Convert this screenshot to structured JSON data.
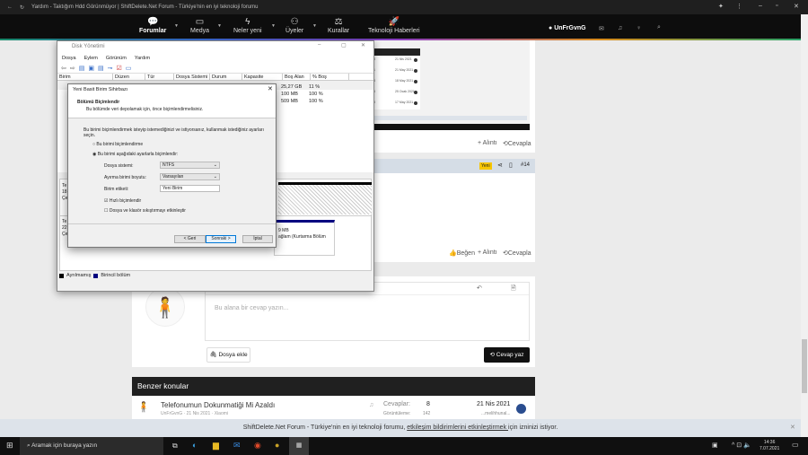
{
  "browser": {
    "tab_title": "Yardım - Taktığım Hdd Görünmüyor | ShiftDelete.Net Forum - Türkiye'nin en iyi teknoloji forumu"
  },
  "nav": {
    "items": [
      {
        "label": "Forumlar",
        "icon": "chat-icon"
      },
      {
        "label": "Medya",
        "icon": "media-icon"
      },
      {
        "label": "Neler yeni",
        "icon": "bolt-icon"
      },
      {
        "label": "Üyeler",
        "icon": "users-icon"
      },
      {
        "label": "Kurallar",
        "icon": "scales-icon"
      },
      {
        "label": "Teknoloji Haberleri",
        "icon": "rocket-icon"
      }
    ],
    "username": "UnFrGvnG"
  },
  "disk_manager": {
    "title": "Disk Yönetimi",
    "menu": [
      "Dosya",
      "Eylem",
      "Görünüm",
      "Yardım"
    ],
    "columns": [
      "Birim",
      "Düzen",
      "Tür",
      "Dosya Sistemi",
      "Durum",
      "Kapasite",
      "Boş Alan",
      "% Boş"
    ],
    "rows": [
      {
        "free": "25,27 GB",
        "pct": "11 %"
      },
      {
        "free": "100 MB",
        "pct": "100 %"
      },
      {
        "free": "509 MB",
        "pct": "100 %"
      }
    ],
    "disk0": [
      "Te",
      "18",
      "Çe"
    ],
    "disk1": [
      "Te",
      "22",
      "Çe"
    ],
    "partition_size": "9 MB",
    "partition_label": "ağlam (Kurtarma Bölüm",
    "legend": [
      {
        "label": "Ayrılmamış",
        "color": "#000000"
      },
      {
        "label": "Birincil bölüm",
        "color": "#000080"
      }
    ]
  },
  "wizard": {
    "title": "Yeni Basit Birim Sihirbazı",
    "heading": "Bölümü Biçimlendir",
    "subheading": "Bu bölümde veri depolamak için, önce biçimlendirmelisiniz.",
    "instruction": "Bu birimi biçimlendirmek isteyip istemediğinizi ve istiyorsanız, kullanmak istediğiniz ayarları seçin.",
    "radio_no": "Bu birimi biçimlendirme",
    "radio_yes": "Bu birimi aşağıdaki ayarlarla biçimlendir:",
    "fs_label": "Dosya sistemi:",
    "fs_value": "NTFS",
    "alloc_label": "Ayırma birimi boyutu:",
    "alloc_value": "Varsayılan",
    "vol_label": "Birim etiketi:",
    "vol_value": "Yeni Birim",
    "quick": "Hızlı biçimlendir",
    "compress": "Dosya ve klasör sıkıştırmayı etkinleştir",
    "back": "< Geri",
    "next": "Sonraki >",
    "cancel": "İptal"
  },
  "post": {
    "quote": "+ Alıntı",
    "reply": "Cevapla",
    "like": "Beğen",
    "new_badge": "Yeni",
    "post_number": "#14"
  },
  "embedded_list": [
    {
      "date": "21 Nis 2021",
      "n": "8"
    },
    {
      "date": "21 May 2021",
      "n": "1"
    },
    {
      "date": "18 May 2021",
      "n": "3"
    },
    {
      "date": "25 Ocak 2021",
      "n": "5"
    },
    {
      "date": "17 May 2021",
      "n": "8"
    }
  ],
  "editor": {
    "placeholder": "Bu alana bir cevap yazın...",
    "attach": "Dosya ekle",
    "submit": "Cevap yaz"
  },
  "similar": {
    "title": "Benzer konular",
    "thread": {
      "title": "Telefonumun Dokunmatiği Mi Azaldı",
      "meta": "UnFrGvnG · 21 Nis 2021 · Xiaomi",
      "replies_label": "Cevaplar:",
      "replies": "8",
      "views_label": "Görüntüleme:",
      "views": "142",
      "last_date": "21 Nis 2021",
      "last_user": "...melihhunal..."
    }
  },
  "notice": {
    "text_before": "ShiftDelete.Net Forum - Türkiye'nin en iyi teknoloji forumu, ",
    "link": "etkileşim bildirimlerini etkinleştirmek ",
    "text_after": "için izninizi istiyor."
  },
  "taskbar": {
    "search_placeholder": "Aramak için buraya yazın",
    "time": "14:36",
    "date": "7.07.2021"
  }
}
